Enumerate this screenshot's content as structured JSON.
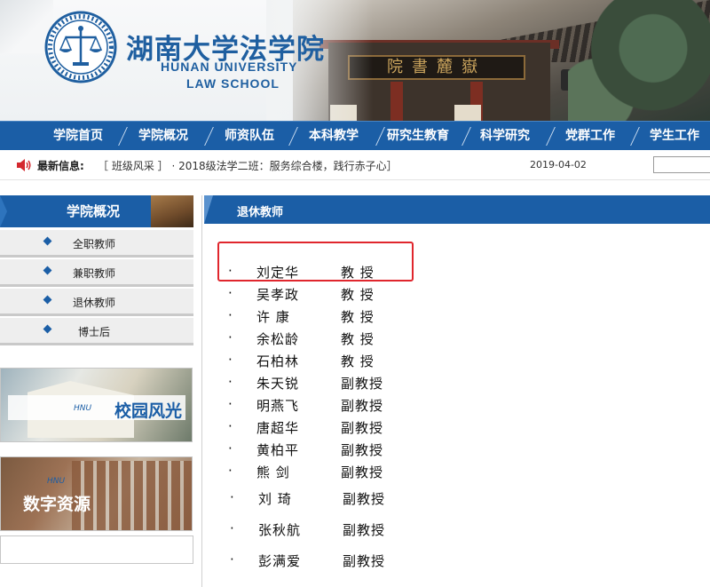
{
  "header": {
    "school_name_cn": "湖南大学法学院",
    "school_name_en_line1": "HUNAN UNIVERSITY",
    "school_name_en_line2": "LAW SCHOOL",
    "plaque_text": "院書麓嶽",
    "accent_color": "#1b5ea6"
  },
  "nav": {
    "items": [
      {
        "label": "学院首页"
      },
      {
        "label": "学院概况"
      },
      {
        "label": "师资队伍"
      },
      {
        "label": "本科教学"
      },
      {
        "label": "研究生教育"
      },
      {
        "label": "科学研究"
      },
      {
        "label": "党群工作"
      },
      {
        "label": "学生工作"
      }
    ]
  },
  "ticker": {
    "label": "最新信息:",
    "text": "［ 班级风采 ］ · 2018级法学二班：服务综合楼，践行赤子心］",
    "date": "2019-04-02",
    "search_value": ""
  },
  "sidebar": {
    "title": "学院概况",
    "items": [
      {
        "label": "全职教师"
      },
      {
        "label": "兼职教师"
      },
      {
        "label": "退休教师"
      },
      {
        "label": "博士后"
      }
    ],
    "promos": [
      {
        "label": "校园风光"
      },
      {
        "label": "数字资源"
      }
    ]
  },
  "content": {
    "title": "退休教师",
    "bullet": "·",
    "teachers": [
      {
        "name": "刘定华",
        "title": "教 授"
      },
      {
        "name": "吴孝政",
        "title": "教 授"
      },
      {
        "name": "许 康",
        "title": "教 授"
      },
      {
        "name": "余松龄",
        "title": "教 授"
      },
      {
        "name": "石柏林",
        "title": "教 授"
      },
      {
        "name": "朱天锐",
        "title": "副教授"
      },
      {
        "name": "明燕飞",
        "title": "副教授"
      },
      {
        "name": "唐超华",
        "title": "副教授"
      },
      {
        "name": "黄柏平",
        "title": "副教授"
      },
      {
        "name": "熊 剑",
        "title": "副教授"
      },
      {
        "name": "刘 琦",
        "title": "副教授"
      },
      {
        "name": "张秋航",
        "title": "副教授"
      },
      {
        "name": "彭满爱",
        "title": "副教授"
      }
    ]
  }
}
